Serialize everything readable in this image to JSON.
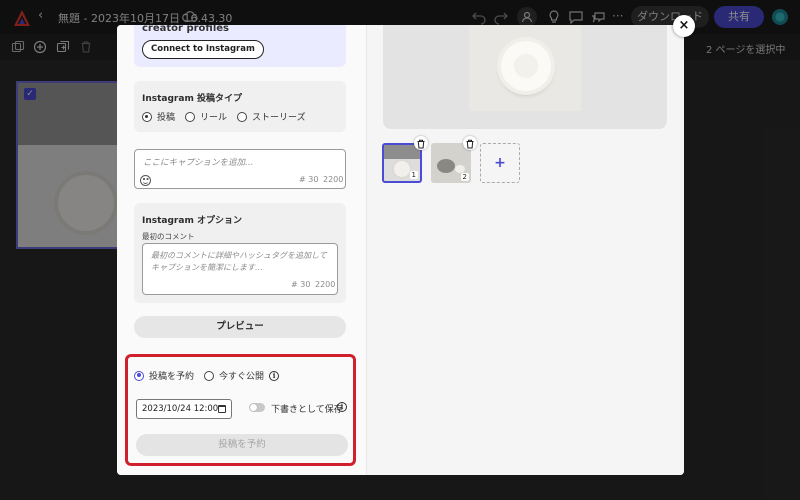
{
  "topbar": {
    "back_icon": "chevron-left-icon",
    "title": "無題 - 2023年10月17日 16.43.30",
    "download_label": "ダウンロード",
    "share_label": "共有"
  },
  "toolbar2": {
    "page_select": "2 ページを選択中"
  },
  "modal": {
    "creator_text": "creator profiles",
    "connect_label": "Connect to Instagram",
    "post_type": {
      "title": "Instagram 投稿タイプ",
      "options": [
        "投稿",
        "リール",
        "ストーリーズ"
      ],
      "selected": "投稿"
    },
    "caption": {
      "placeholder": "ここにキャプションを追加…",
      "hashtag_count": "# 30",
      "char_count": "2200"
    },
    "options": {
      "title": "Instagram オプション",
      "first_comment_label": "最初のコメント",
      "comment_placeholder": "最初のコメントに詳細やハッシュタグを追加してキャプションを簡潔にします…",
      "hashtag_count": "# 30",
      "char_count": "2200"
    },
    "preview_label": "プレビュー",
    "schedule": {
      "option_schedule": "投稿を予約",
      "option_now": "今すぐ公開",
      "selected": "投稿を予約",
      "datetime": "2023/10/24 12:00",
      "draft_label": "下書きとして保存",
      "draft_on": false,
      "button_label": "投稿を予約"
    },
    "thumbnails": [
      {
        "num": "1",
        "selected": true
      },
      {
        "num": "2",
        "selected": false
      }
    ],
    "add_label": "+",
    "close_label": "×"
  },
  "colors": {
    "accent": "#4b4bd6",
    "highlight": "#d0202e"
  }
}
